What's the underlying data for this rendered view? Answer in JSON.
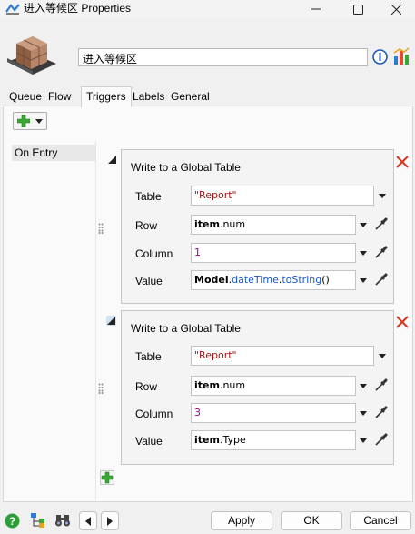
{
  "window": {
    "title": "进入等候区  Properties",
    "controls": {
      "minimize": "─",
      "maximize": "☐",
      "close": "✕"
    }
  },
  "header": {
    "object_name": "进入等候区",
    "icons": [
      "box-stack-icon",
      "info-icon",
      "statistics-icon"
    ]
  },
  "tabs": [
    {
      "label": "Queue"
    },
    {
      "label": "Flow"
    },
    {
      "label": "Triggers",
      "active": true
    },
    {
      "label": "Labels"
    },
    {
      "label": "General"
    }
  ],
  "triggers": {
    "list": [
      {
        "label": "On Entry",
        "selected": true
      }
    ],
    "commands": [
      {
        "title": "Write to a Global Table",
        "fields": [
          {
            "label": "Table",
            "value": "\"Report\""
          },
          {
            "label": "Row",
            "value": "item.num"
          },
          {
            "label": "Column",
            "value": "1"
          },
          {
            "label": "Value",
            "value": "Model.dateTime.toString()"
          }
        ]
      },
      {
        "title": "Write to a Global Table",
        "fields": [
          {
            "label": "Table",
            "value": "\"Report\""
          },
          {
            "label": "Row",
            "value": "item.num"
          },
          {
            "label": "Column",
            "value": "3"
          },
          {
            "label": "Value",
            "value": "item.Type"
          }
        ]
      }
    ]
  },
  "footer": {
    "apply_label": "Apply",
    "ok_label": "OK",
    "cancel_label": "Cancel"
  },
  "colors": {
    "accent_green": "#3aa832",
    "remove_red": "#e0321e",
    "string_literal": "#a31515",
    "number_literal": "#a000a0",
    "member": "#1a56c8"
  }
}
